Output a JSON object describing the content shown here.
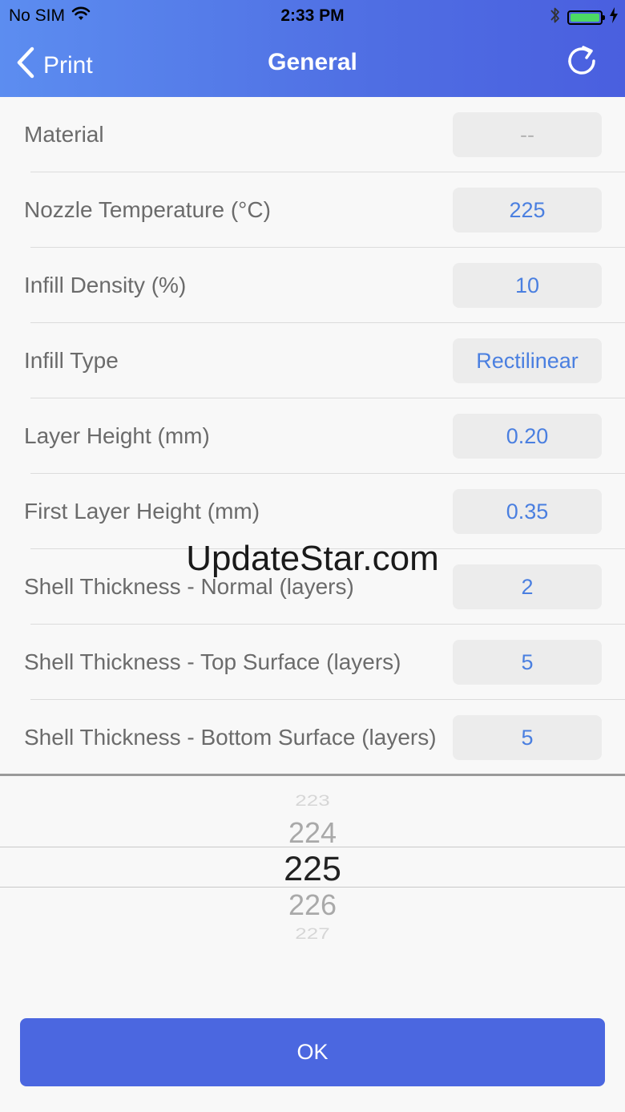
{
  "status_bar": {
    "carrier": "No SIM",
    "time": "2:33 PM"
  },
  "nav": {
    "back_label": "Print",
    "title": "General",
    "refresh_icon": "refresh-icon"
  },
  "settings": [
    {
      "label": "Material",
      "value": "--"
    },
    {
      "label": "Nozzle Temperature (°C)",
      "value": "225"
    },
    {
      "label": "Infill Density (%)",
      "value": "10"
    },
    {
      "label": "Infill Type",
      "value": "Rectilinear"
    },
    {
      "label": "Layer Height (mm)",
      "value": "0.20"
    },
    {
      "label": "First Layer Height (mm)",
      "value": "0.35"
    },
    {
      "label": "Shell Thickness - Normal (layers)",
      "value": "2"
    },
    {
      "label": "Shell Thickness - Top Surface (layers)",
      "value": "5"
    },
    {
      "label": "Shell Thickness - Bottom Surface (layers)",
      "value": "5"
    }
  ],
  "picker": {
    "options": [
      "223",
      "224",
      "225",
      "226",
      "227"
    ],
    "selected": "225"
  },
  "ok_label": "OK",
  "watermark": "UpdateStar.com",
  "colors": {
    "header_start": "#5c8df0",
    "header_end": "#4a5fdf",
    "value_text": "#4a7fe0",
    "ok_button": "#4b67e0",
    "battery": "#4cd964"
  }
}
